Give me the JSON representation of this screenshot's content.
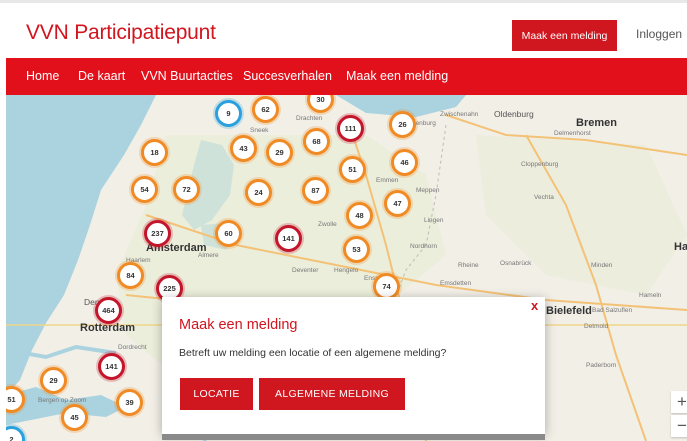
{
  "header": {
    "brand": "VVN Participatiepunt",
    "report_button": "Maak een melding",
    "login": "Inloggen"
  },
  "nav": {
    "items": [
      "Home",
      "De kaart",
      "VVN Buurtacties",
      "Succesverhalen",
      "Maak een melding"
    ]
  },
  "map": {
    "clusters": [
      {
        "count": "2",
        "color": "blue"
      },
      {
        "count": "9",
        "color": "blue"
      },
      {
        "count": "62",
        "color": "orange"
      },
      {
        "count": "30",
        "color": "orange"
      },
      {
        "count": "111",
        "color": "red"
      },
      {
        "count": "26",
        "color": "orange"
      },
      {
        "count": "18",
        "color": "orange"
      },
      {
        "count": "43",
        "color": "orange"
      },
      {
        "count": "29",
        "color": "orange"
      },
      {
        "count": "68",
        "color": "orange"
      },
      {
        "count": "51",
        "color": "orange"
      },
      {
        "count": "46",
        "color": "orange"
      },
      {
        "count": "54",
        "color": "orange"
      },
      {
        "count": "72",
        "color": "orange"
      },
      {
        "count": "24",
        "color": "orange"
      },
      {
        "count": "87",
        "color": "orange"
      },
      {
        "count": "47",
        "color": "orange"
      },
      {
        "count": "48",
        "color": "orange"
      },
      {
        "count": "237",
        "color": "red"
      },
      {
        "count": "60",
        "color": "orange"
      },
      {
        "count": "141",
        "color": "red"
      },
      {
        "count": "53",
        "color": "orange"
      },
      {
        "count": "84",
        "color": "orange"
      },
      {
        "count": "225",
        "color": "red"
      },
      {
        "count": "74",
        "color": "orange"
      },
      {
        "count": "464",
        "color": "red"
      },
      {
        "count": "141",
        "color": "red"
      },
      {
        "count": "29",
        "color": "orange"
      },
      {
        "count": "51",
        "color": "orange"
      },
      {
        "count": "39",
        "color": "orange"
      },
      {
        "count": "45",
        "color": "orange"
      }
    ],
    "cities": [
      "Oldenburg",
      "Bremen",
      "Delmenhorst",
      "Zwischenahn",
      "Papenburg",
      "Drachten",
      "Sneek",
      "Cloppenburg",
      "Emmen",
      "Meppen",
      "Vechta",
      "Lingen",
      "Zwolle",
      "Amsterdam",
      "Haarlem",
      "Almere",
      "Nordhorn",
      "Deventer",
      "Hengelo",
      "Rheine",
      "Osnabrück",
      "Minden",
      "Enschede",
      "Emsdetten",
      "Hameln",
      "Bielefeld",
      "Bad Salzuflen",
      "Detmold",
      "Paderborn",
      "Rotterdam",
      "Dordrecht",
      "Bergen op Zoom",
      "Den",
      "Ha"
    ],
    "zoom_in": "+",
    "zoom_out": "−"
  },
  "modal": {
    "close": "x",
    "title": "Maak een melding",
    "question": "Betreft uw melding een locatie of een algemene melding?",
    "location_button": "LOCATIE",
    "general_button": "ALGEMENE MELDING"
  },
  "colors": {
    "brand_red": "#d0161f",
    "nav_red": "#e2101b",
    "cluster_orange": "#f08a24",
    "cluster_red": "#c3162b",
    "cluster_blue": "#2aa0dd",
    "water": "#aad3df",
    "land": "#f2efe7"
  }
}
